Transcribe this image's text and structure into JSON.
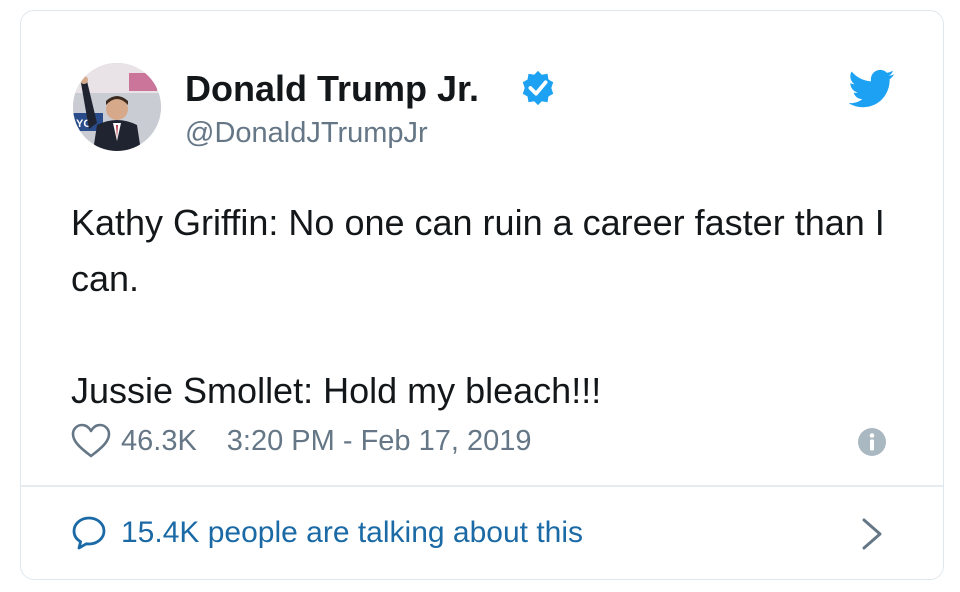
{
  "tweet": {
    "author": {
      "display_name": "Donald Trump Jr.",
      "handle": "@DonaldJTrumpJr",
      "verified": true,
      "avatar_icon": "profile-photo"
    },
    "text": "Kathy Griffin: No one can ruin a career faster than I can.\n\nJussie Smollet: Hold my bleach!!!",
    "likes": "46.3K",
    "timestamp": "3:20 PM - Feb 17, 2019",
    "footer_text": "15.4K people are talking about this"
  },
  "icons": {
    "brand": "twitter-bird-icon",
    "verified": "verified-badge-icon",
    "like": "heart-icon",
    "info": "info-icon",
    "conversation": "speech-bubble-icon",
    "more": "chevron-right-icon"
  },
  "colors": {
    "brand_blue": "#1da1f2",
    "link_blue": "#1b6aa6",
    "text_primary": "#14171a",
    "text_secondary": "#657786",
    "border": "#e1e8ed"
  }
}
